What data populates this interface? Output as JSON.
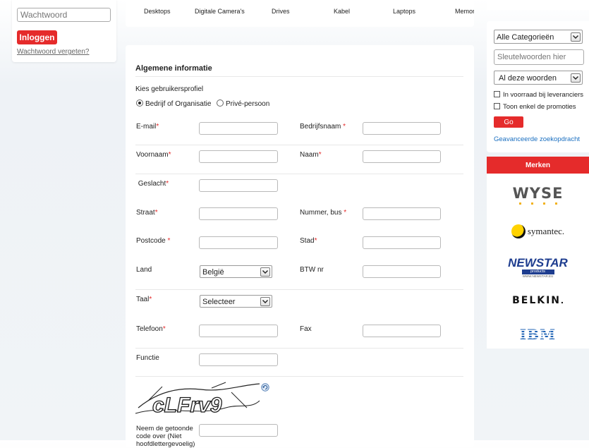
{
  "login": {
    "password_placeholder": "Wachtwoord",
    "login_button": "Inloggen",
    "forgot_link": "Wachtwoord vergeten?"
  },
  "nav": {
    "items": [
      "Desktops",
      "Digitale Camera's",
      "Drives",
      "Kabel",
      "Laptops",
      "Memory"
    ]
  },
  "form": {
    "section_title": "Algemene informatie",
    "profile_label": "Kies gebruikersprofiel",
    "profile_options": [
      "Bedrijf of Organisatie",
      "Privé-persoon"
    ],
    "fields": {
      "email": "E-mail",
      "company": "Bedrijfsnaam ",
      "firstname": "Voornaam",
      "lastname": "Naam",
      "gender": " Geslacht",
      "street": "Straat",
      "number": "Nummer, bus ",
      "postcode": "Postcode ",
      "city": "Stad",
      "country": "Land",
      "vat": "BTW nr",
      "language": "Taal",
      "phone": "Telefoon",
      "fax": "Fax",
      "function": "Functie",
      "captcha": "Neem de getoonde code over (Niet hoofdlettergevoelig)"
    },
    "required_mark": "*",
    "country_value": "België",
    "language_value": "Selecteer",
    "captcha_text": "cLFrv9"
  },
  "search": {
    "category_value": "Alle Categorieën",
    "keywords_placeholder": "Sleutelwoorden hier",
    "mode_value": "Al deze woorden",
    "check_stock": "In voorraad bij leveranciers",
    "check_promos": "Toon enkel de promoties",
    "go_button": "Go",
    "advanced_link": "Geavanceerde zoekopdracht"
  },
  "brands": {
    "title": "Merken",
    "items": [
      "WYSE",
      "symantec.",
      "NEWSTAR",
      "products",
      "WWW.NEWSTAR.EU",
      "BELKIN",
      ".",
      "IBM"
    ]
  },
  "colors": {
    "accent": "#e52b2b",
    "link": "#1a6fc0"
  }
}
